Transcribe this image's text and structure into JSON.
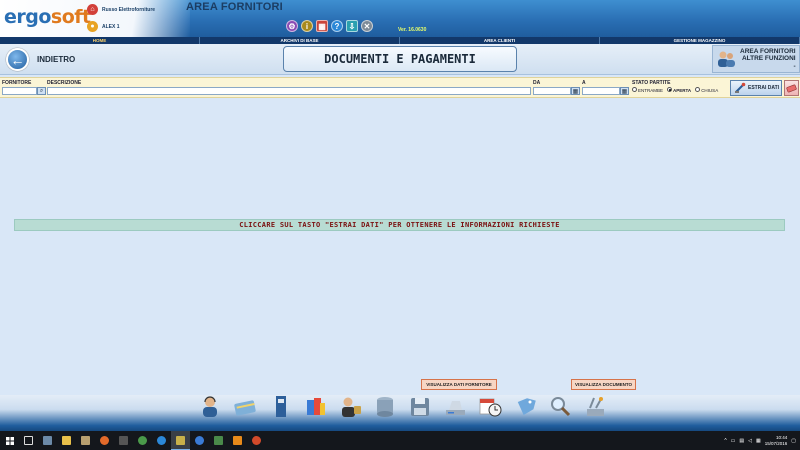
{
  "header": {
    "logo_part1": "ergo",
    "logo_part2": "soft",
    "company": "Russo Elettroforniture",
    "user": "ALEX 1",
    "area_title": "AREA FORNITORI",
    "version": "Ver. 16.0630"
  },
  "nav": {
    "items": [
      "HOME",
      "ARCHIVI DI BASE",
      "AREA CLIENTI",
      "GESTIONE MAGAZZINO"
    ]
  },
  "titlebar": {
    "back_label": "INDIETRO",
    "page_title": "DOCUMENTI E PAGAMENTI",
    "area_button_line1": "AREA FORNITORI",
    "area_button_line2": "ALTRE FUNZIONI",
    "area_button_line3": "-"
  },
  "filter": {
    "fornitore_label": "FORNITORE",
    "descrizione_label": "DESCRIZIONE",
    "da_label": "DA",
    "a_label": "A",
    "stato_label": "STATO PARTITE",
    "fornitore_value": "",
    "descrizione_value": "",
    "da_value": "",
    "a_value": "",
    "stato_options": [
      "ENTRAMBE",
      "APERTA",
      "CHIUSA"
    ],
    "stato_selected": "APERTA",
    "estrai_label": "ESTRAI DATI"
  },
  "message": "CLICCARE SUL TASTO \"ESTRAI DATI\" PER OTTENERE LE INFORMAZIONI RICHIESTE",
  "actions": {
    "visualizza_fornitore": "VISUALIZZA DATI FORNITORE",
    "visualizza_documento": "VISUALIZZA DOCUMENTO"
  },
  "toolbar_icons": [
    "customer-service-icon",
    "payment-card-icon",
    "binder-icon",
    "reports-icon",
    "security-agent-icon",
    "database-icon",
    "save-disk-icon",
    "scanner-icon",
    "calendar-clock-icon",
    "tag-icon",
    "search-icon",
    "tools-icon"
  ],
  "taskbar": {
    "time": "10:44",
    "date": "15/07/2016"
  },
  "colors": {
    "header_blue": "#2a6fb4",
    "nav_dark": "#12386a",
    "message_bg": "#b8dcd3",
    "message_text": "#7a1010",
    "action_bg": "#f7d6c4"
  }
}
